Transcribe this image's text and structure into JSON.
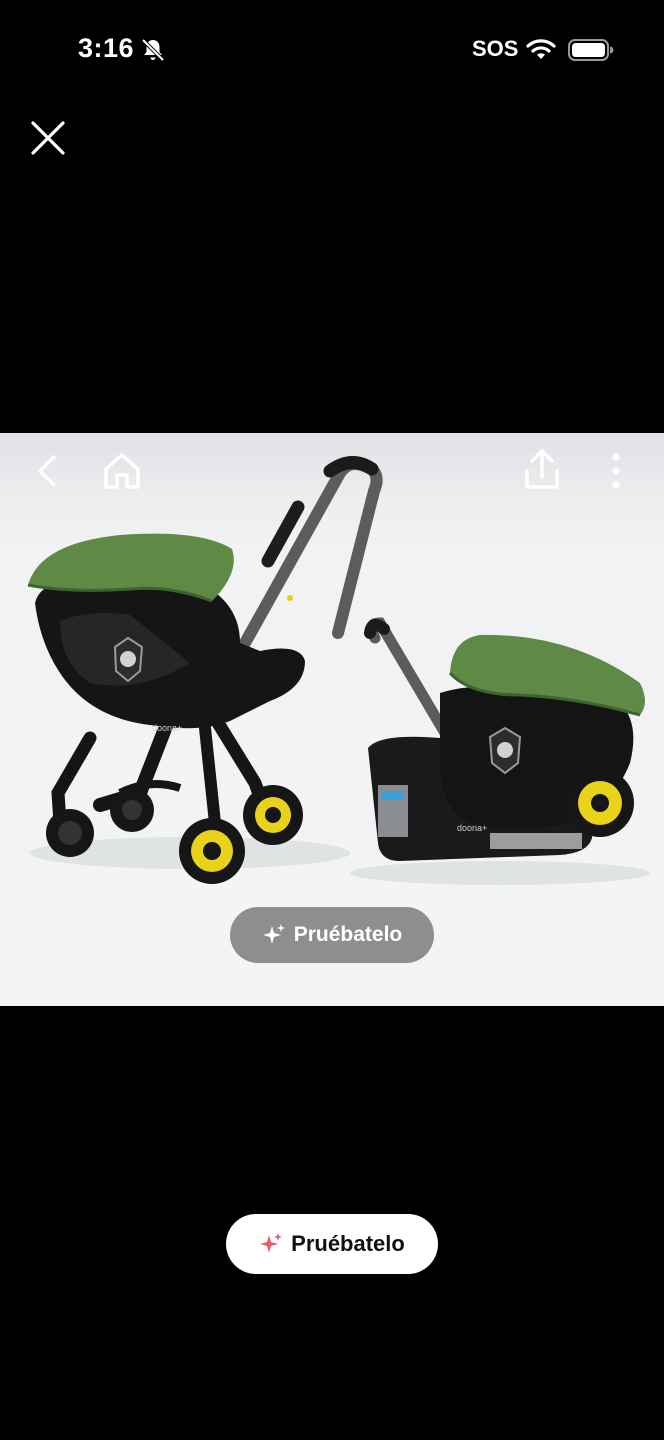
{
  "status_bar": {
    "time": "3:16",
    "carrier": "SOS",
    "icons": [
      "bell-slash-icon",
      "wifi-icon",
      "battery-icon"
    ]
  },
  "toolbar_icons": {
    "close": "close-icon",
    "back": "chevron-left-icon",
    "home": "home-icon",
    "share": "share-icon",
    "more": "more-vertical-icon"
  },
  "product": {
    "brand_mark": "doona+"
  },
  "overlay_try_button": {
    "label": "Pruébatelo",
    "icon": "sparkle-icon"
  },
  "try_button": {
    "label": "Pruébatelo",
    "icon": "sparkle-icon"
  },
  "colors": {
    "background": "#000000",
    "canopy_green": "#5e8a46",
    "wheel_yellow": "#e8d21a",
    "frame_black": "#141414",
    "sparkle_orange": "#f06a3a",
    "sparkle_pink": "#e8508a"
  }
}
